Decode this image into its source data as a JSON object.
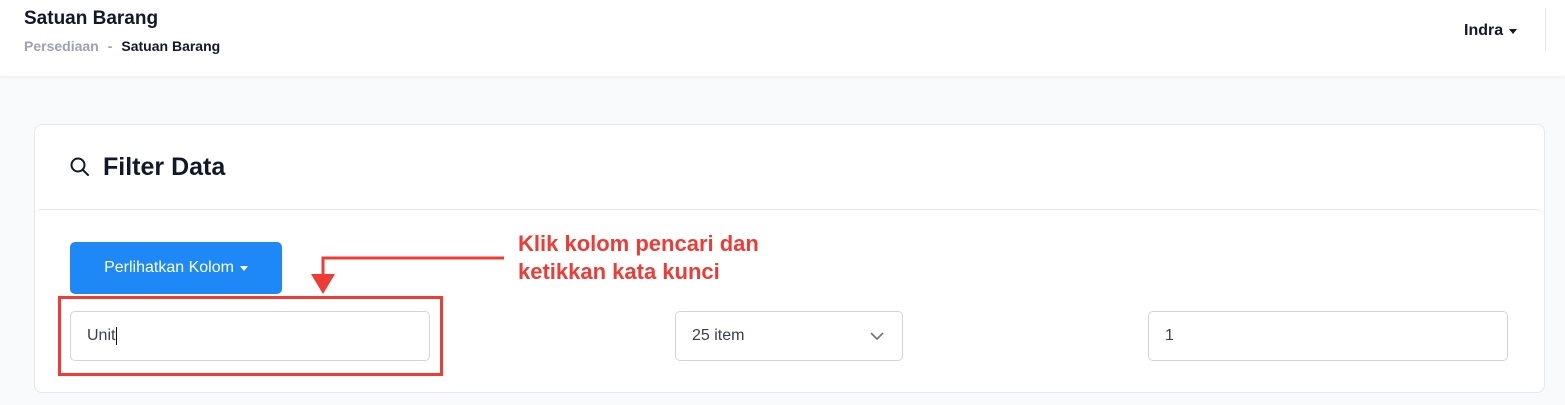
{
  "header": {
    "title": "Satuan Barang",
    "breadcrumb": {
      "parent": "Persediaan",
      "separator": "-",
      "current": "Satuan Barang"
    },
    "user": {
      "name": "Indra"
    }
  },
  "filter_card": {
    "title": "Filter Data",
    "columns_button": "Perlihatkan Kolom",
    "search": {
      "value": "Unit"
    },
    "per_page": {
      "selected": "25 item"
    },
    "page": {
      "value": "1"
    }
  },
  "annotation": {
    "line1": "Klik kolom pencari dan",
    "line2": "ketikkan kata kunci"
  },
  "colors": {
    "primary": "#1e88f7",
    "annotation": "#ef3b36"
  }
}
